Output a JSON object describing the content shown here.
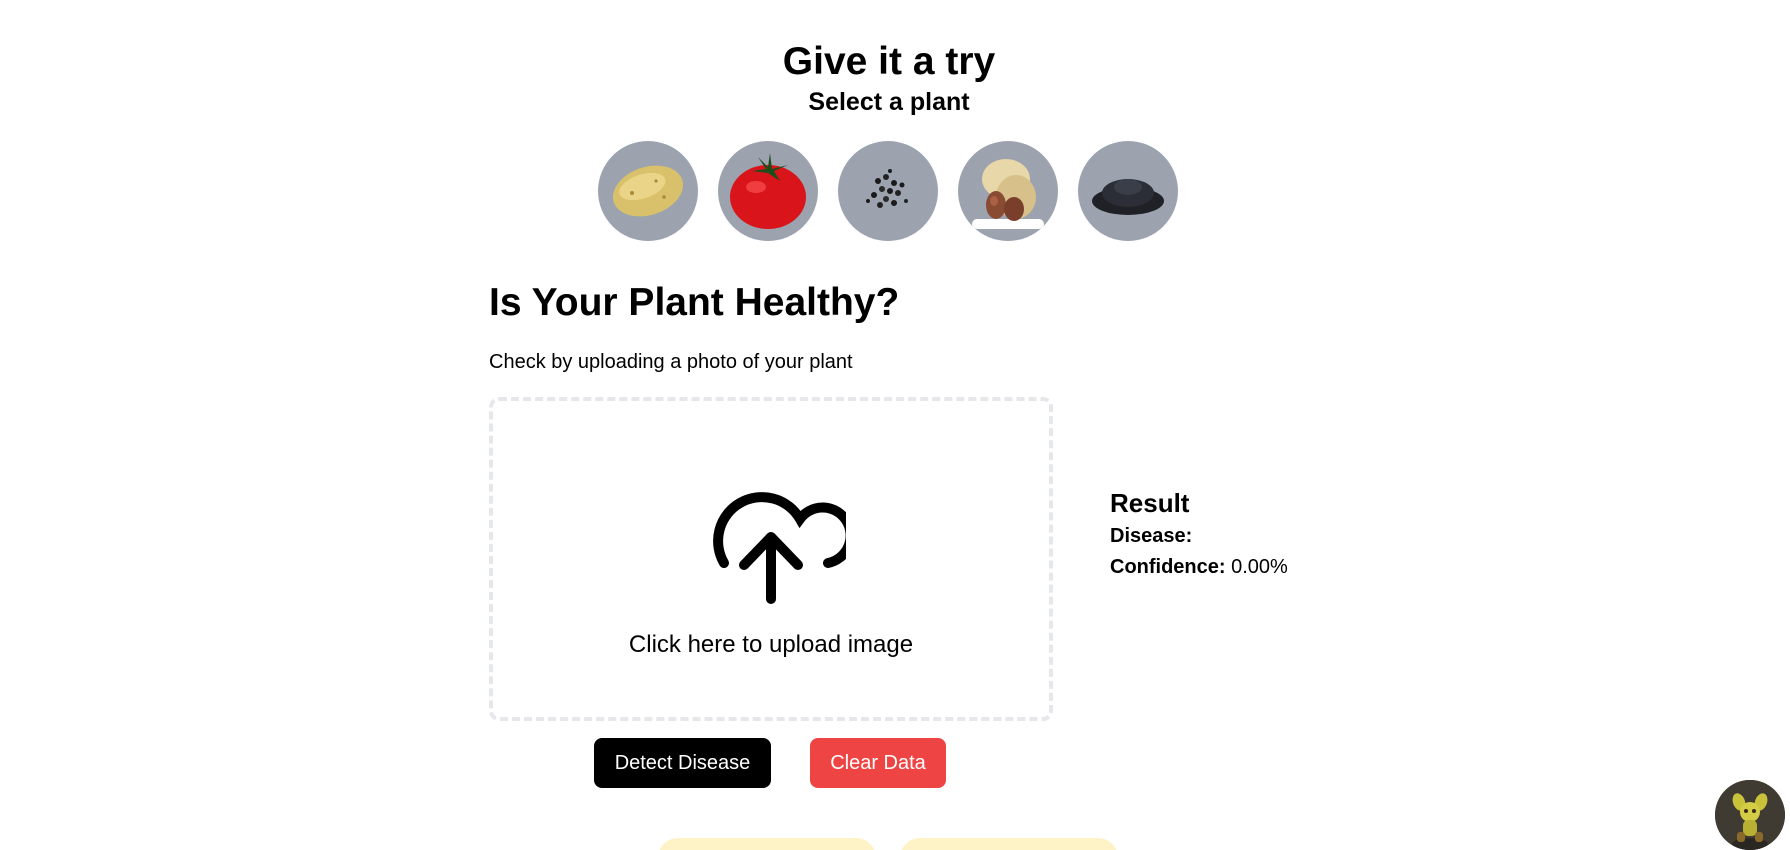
{
  "header": {
    "title": "Give it a try",
    "subtitle": "Select a plant"
  },
  "plants": [
    {
      "icon": "potato-icon"
    },
    {
      "icon": "tomato-icon"
    },
    {
      "icon": "pepper-icon"
    },
    {
      "icon": "peanut-icon"
    },
    {
      "icon": "seeds-icon"
    }
  ],
  "main": {
    "title": "Is Your Plant Healthy?",
    "description": "Check by uploading a photo of your plant",
    "upload_label": "Click here to upload image",
    "upload_icon": "cloud-upload-icon"
  },
  "result": {
    "title": "Result",
    "disease_label": "Disease:",
    "disease_value": "",
    "confidence_label": "Confidence:",
    "confidence_value": "0.00%"
  },
  "buttons": {
    "detect_label": "Detect Disease",
    "clear_label": "Clear Data"
  },
  "colors": {
    "plant_circle": "#9ca3af",
    "detect_button": "#000000",
    "clear_button": "#ef4444",
    "dashed_border": "#e5e7eb",
    "pill": "#fef3c7"
  }
}
